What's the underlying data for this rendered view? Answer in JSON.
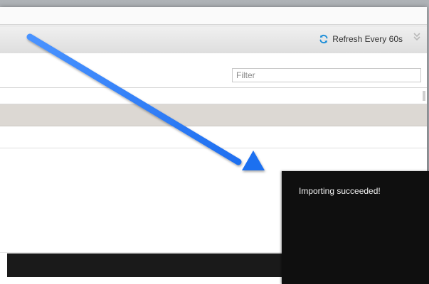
{
  "header": {
    "refresh_label": "Refresh Every 60s",
    "refresh_icon": "refresh-icon",
    "collapse_icon": "double-chevron-down-icon"
  },
  "filter": {
    "placeholder": "Filter",
    "value": ""
  },
  "toast": {
    "message": "Importing succeeded!"
  },
  "annotation": {
    "type": "arrow",
    "color": "#2f7df6"
  },
  "colors": {
    "accent": "#2f7df6",
    "refresh_icon": "#1f8fd8",
    "band_row": "#dcd8d3",
    "toast_bg": "#0f0f0f"
  }
}
